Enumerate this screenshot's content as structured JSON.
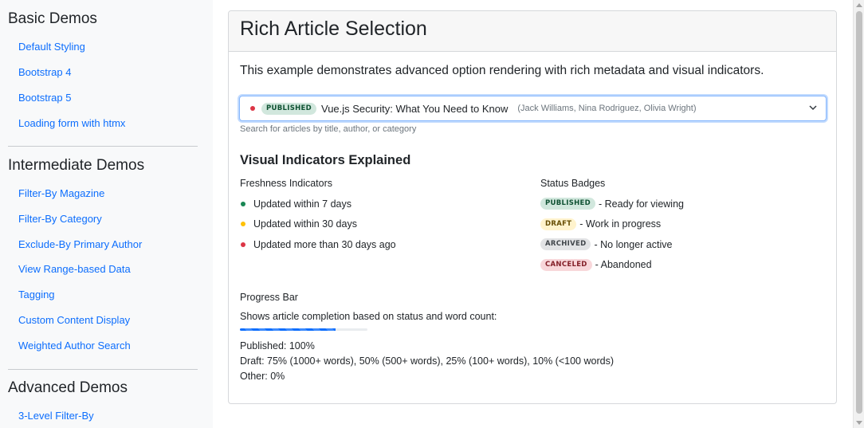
{
  "sidebar": {
    "sections": [
      {
        "heading": "Basic Demos",
        "items": [
          "Default Styling",
          "Bootstrap 4",
          "Bootstrap 5",
          "Loading form with htmx"
        ]
      },
      {
        "heading": "Intermediate Demos",
        "items": [
          "Filter-By Magazine",
          "Filter-By Category",
          "Exclude-By Primary Author",
          "View Range-based Data",
          "Tagging",
          "Custom Content Display",
          "Weighted Author Search"
        ]
      },
      {
        "heading": "Advanced Demos",
        "items": [
          "3-Level Filter-By"
        ]
      }
    ]
  },
  "main": {
    "title": "Rich Article Selection",
    "intro": "This example demonstrates advanced option rendering with rich metadata and visual indicators.",
    "select": {
      "badge": "PUBLISHED",
      "title": "Vue.js Security: What You Need to Know",
      "authors": "(Jack Williams, Nina Rodriguez, Olivia Wright)",
      "freshness_color": "#dc3545"
    },
    "help_text": "Search for articles by title, author, or category",
    "indicators_heading": "Visual Indicators Explained",
    "freshness": {
      "heading": "Freshness Indicators",
      "items": [
        {
          "color": "green",
          "text": "Updated within 7 days"
        },
        {
          "color": "yellow",
          "text": "Updated within 30 days"
        },
        {
          "color": "red",
          "text": "Updated more than 30 days ago"
        }
      ]
    },
    "status": {
      "heading": "Status Badges",
      "items": [
        {
          "badge": "PUBLISHED",
          "kind": "pub",
          "text": "- Ready for viewing"
        },
        {
          "badge": "DRAFT",
          "kind": "draft",
          "text": "- Work in progress"
        },
        {
          "badge": "ARCHIVED",
          "kind": "arch",
          "text": "- No longer active"
        },
        {
          "badge": "CANCELED",
          "kind": "canc",
          "text": "- Abandoned"
        }
      ]
    },
    "progress": {
      "heading": "Progress Bar",
      "description": "Shows article completion based on status and word count:",
      "value_percent": 75,
      "lines": [
        "Published: 100%",
        "Draft: 75% (1000+ words), 50% (500+ words), 25% (100+ words), 10% (<100 words)",
        "Other: 0%"
      ]
    }
  },
  "colors": {
    "accent": "#0d6efd",
    "green": "#198754",
    "yellow": "#ffc107",
    "red": "#dc3545"
  }
}
